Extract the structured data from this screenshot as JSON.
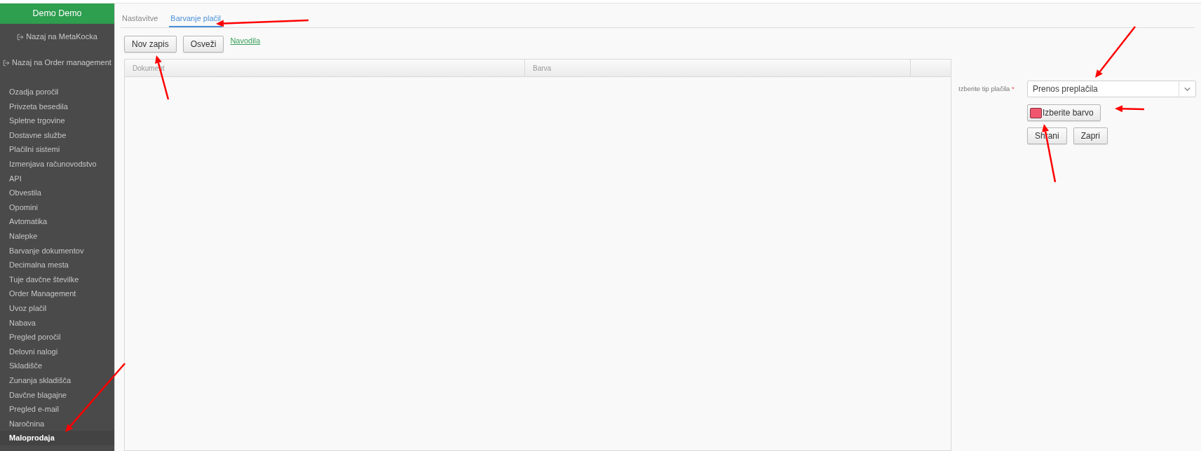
{
  "app": {
    "title": "Demo Demo"
  },
  "back_links": [
    {
      "label": "Nazaj na MetaKocka"
    },
    {
      "label": "Nazaj na Order management"
    }
  ],
  "sidebar": {
    "items": [
      {
        "label": "Ozadja poročil",
        "selected": false
      },
      {
        "label": "Privzeta besedila",
        "selected": false
      },
      {
        "label": "Spletne trgovine",
        "selected": false
      },
      {
        "label": "Dostavne službe",
        "selected": false
      },
      {
        "label": "Plačilni sistemi",
        "selected": false
      },
      {
        "label": "Izmenjava računovodstvo",
        "selected": false
      },
      {
        "label": "API",
        "selected": false
      },
      {
        "label": "Obvestila",
        "selected": false
      },
      {
        "label": "Opomini",
        "selected": false
      },
      {
        "label": "Avtomatika",
        "selected": false
      },
      {
        "label": "Nalepke",
        "selected": false
      },
      {
        "label": "Barvanje dokumentov",
        "selected": false
      },
      {
        "label": "Decimalna mesta",
        "selected": false
      },
      {
        "label": "Tuje davčne številke",
        "selected": false
      },
      {
        "label": "Order Management",
        "selected": false
      },
      {
        "label": "Uvoz plačil",
        "selected": false
      },
      {
        "label": "Nabava",
        "selected": false
      },
      {
        "label": "Pregled poročil",
        "selected": false
      },
      {
        "label": "Delovni nalogi",
        "selected": false
      },
      {
        "label": "Skladišče",
        "selected": false
      },
      {
        "label": "Zunanja skladišča",
        "selected": false
      },
      {
        "label": "Davčne blagajne",
        "selected": false
      },
      {
        "label": "Pregled e-mail",
        "selected": false
      },
      {
        "label": "Naročnina",
        "selected": false
      },
      {
        "label": "Maloprodaja",
        "selected": true
      }
    ]
  },
  "tabs": [
    {
      "label": "Nastavitve",
      "selected": false
    },
    {
      "label": "Barvanje plačil",
      "selected": true
    }
  ],
  "toolbar": {
    "buttons": [
      "Nov zapis",
      "Osveži"
    ],
    "link": "Navodila"
  },
  "table": {
    "columns": [
      "Dokument",
      "Barva"
    ]
  },
  "form": {
    "payment_type_label": "Izberite tip plačila",
    "required_mark": "*",
    "payment_type_value": "Prenos preplačila",
    "color_button": "Izberite barvo",
    "color": "#f0566e",
    "buttons": [
      "Shrani",
      "Zapri"
    ]
  }
}
